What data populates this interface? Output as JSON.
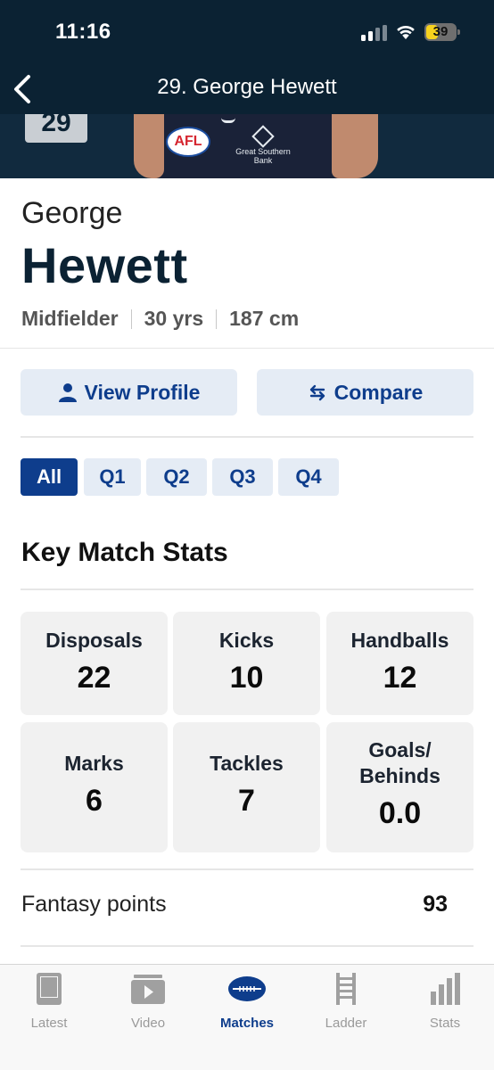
{
  "status_bar": {
    "time": "11:16",
    "battery": "39"
  },
  "header": {
    "title": "29. George Hewett"
  },
  "hero": {
    "jersey_number": "29",
    "logo_text": "AFL",
    "sponsor_text": "Great Southern Bank"
  },
  "player": {
    "first_name": "George",
    "last_name": "Hewett",
    "position": "Midfielder",
    "age": "30 yrs",
    "height": "187 cm"
  },
  "actions": {
    "view_profile": "View Profile",
    "compare": "Compare"
  },
  "quarters": [
    "All",
    "Q1",
    "Q2",
    "Q3",
    "Q4"
  ],
  "active_quarter": "All",
  "key_stats": {
    "title": "Key Match Stats",
    "items": [
      {
        "label": "Disposals",
        "value": "22"
      },
      {
        "label": "Kicks",
        "value": "10"
      },
      {
        "label": "Handballs",
        "value": "12"
      },
      {
        "label": "Marks",
        "value": "6"
      },
      {
        "label": "Tackles",
        "value": "7"
      },
      {
        "label_line1": "Goals/",
        "label_line2": "Behinds",
        "value": "0.0"
      }
    ]
  },
  "fantasy": {
    "label": "Fantasy points",
    "value": "93"
  },
  "tabbar": {
    "items": [
      {
        "label": "Latest",
        "icon": "latest-icon"
      },
      {
        "label": "Video",
        "icon": "video-icon"
      },
      {
        "label": "Matches",
        "icon": "football-icon"
      },
      {
        "label": "Ladder",
        "icon": "ladder-icon"
      },
      {
        "label": "Stats",
        "icon": "bar-chart-icon"
      }
    ],
    "active": "Matches"
  },
  "colors": {
    "header_bg": "#0b2233",
    "accent": "#0e3d8c",
    "button_bg": "#e5ecf5",
    "card_bg": "#f1f1f1"
  }
}
